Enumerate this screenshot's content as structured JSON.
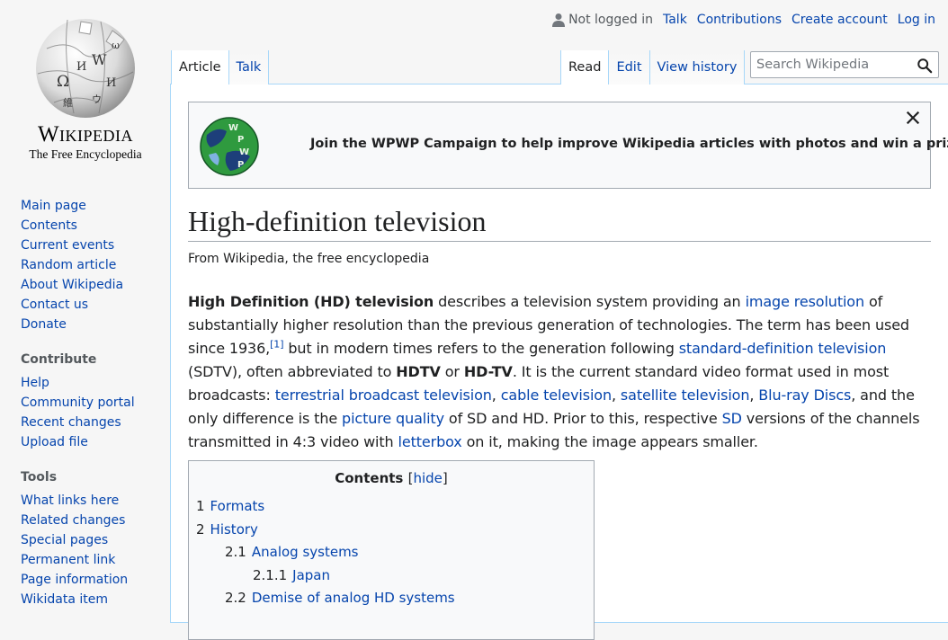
{
  "logo": {
    "wordmark": "Wikipedia",
    "tagline": "The Free Encyclopedia"
  },
  "personal": {
    "not_logged_in": "Not logged in",
    "talk": "Talk",
    "contributions": "Contributions",
    "create_account": "Create account",
    "log_in": "Log in"
  },
  "tabs": {
    "article": "Article",
    "talk": "Talk",
    "read": "Read",
    "edit": "Edit",
    "view_history": "View history"
  },
  "search": {
    "placeholder": "Search Wikipedia"
  },
  "sidebar": {
    "navigation": [
      "Main page",
      "Contents",
      "Current events",
      "Random article",
      "About Wikipedia",
      "Contact us",
      "Donate"
    ],
    "contribute_heading": "Contribute",
    "contribute": [
      "Help",
      "Community portal",
      "Recent changes",
      "Upload file"
    ],
    "tools_heading": "Tools",
    "tools": [
      "What links here",
      "Related changes",
      "Special pages",
      "Permanent link",
      "Page information",
      "Wikidata item"
    ]
  },
  "banner": {
    "text": "Join the WPWP Campaign to help improve Wikipedia articles with photos and win a prize"
  },
  "article": {
    "title": "High-definition television",
    "tagline": "From Wikipedia, the free encyclopedia",
    "lead": [
      {
        "t": "High Definition (HD) television",
        "b": true
      },
      {
        "t": " describes a television system providing an "
      },
      {
        "t": "image resolution",
        "link": true
      },
      {
        "t": " of substantially higher resolution than the previous generation of technologies. The term has been used since 1936,"
      },
      {
        "t": "[1]",
        "link": true,
        "sup": true
      },
      {
        "t": " but in modern times refers to the generation following "
      },
      {
        "t": "standard-definition television",
        "link": true
      },
      {
        "t": " (SDTV), often abbreviated to "
      },
      {
        "t": "HDTV",
        "b": true
      },
      {
        "t": " or "
      },
      {
        "t": "HD-TV",
        "b": true
      },
      {
        "t": ". It is the current standard video format used in most broadcasts: "
      },
      {
        "t": "terrestrial broadcast television",
        "link": true
      },
      {
        "t": ", "
      },
      {
        "t": "cable television",
        "link": true
      },
      {
        "t": ", "
      },
      {
        "t": "satellite television",
        "link": true
      },
      {
        "t": ", "
      },
      {
        "t": "Blu-ray Discs",
        "link": true
      },
      {
        "t": ", and the only difference is the "
      },
      {
        "t": "picture quality",
        "link": true
      },
      {
        "t": " of SD and HD. Prior to this, respective "
      },
      {
        "t": "SD",
        "link": true
      },
      {
        "t": " versions of the channels transmitted in 4:3 video with "
      },
      {
        "t": "letterbox",
        "link": true
      },
      {
        "t": " on it, making the image appears smaller."
      }
    ]
  },
  "toc": {
    "title": "Contents",
    "open_bracket": "[",
    "toggle": "hide",
    "close_bracket": "]",
    "items": [
      {
        "num": "1",
        "label": "Formats",
        "level": 1
      },
      {
        "num": "2",
        "label": "History",
        "level": 1
      },
      {
        "num": "2.1",
        "label": "Analog systems",
        "level": 2
      },
      {
        "num": "2.1.1",
        "label": "Japan",
        "level": 3
      },
      {
        "num": "2.2",
        "label": "Demise of analog HD systems",
        "level": 2
      }
    ]
  }
}
